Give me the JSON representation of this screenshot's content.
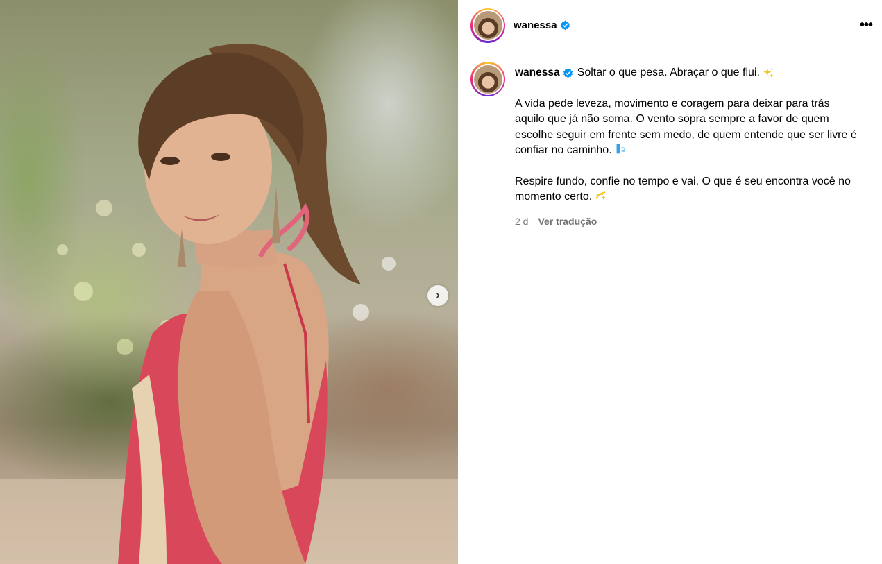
{
  "header": {
    "username": "wanessa",
    "more_label": "•••"
  },
  "media": {
    "next_arrow": "›"
  },
  "caption": {
    "username": "wanessa",
    "title": "Soltar o que pesa. Abraçar o que flui.",
    "title_emoji": "sparkles-emoji",
    "paragraph_1": "A vida pede leveza, movimento e coragem para deixar para trás aquilo que já não soma. O vento sopra sempre a favor de quem escolhe seguir em frente sem medo, de quem entende que ser livre é confiar no caminho.",
    "paragraph_1_emoji": "wind-emoji",
    "paragraph_2": "Respire fundo, confie no tempo e vai. O que é seu encontra você no momento certo.",
    "paragraph_2_emoji": "dizzy-emoji",
    "time_ago": "2 d",
    "translate_label": "Ver tradução"
  },
  "colors": {
    "verified": "#0095f6",
    "meta_text": "#737373",
    "dress": "#d9485a"
  }
}
